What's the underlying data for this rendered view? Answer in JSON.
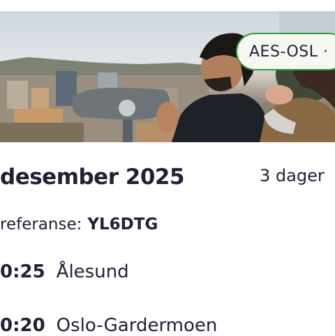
{
  "hero": {
    "image": "city-viewpoint-photo",
    "route_chip": "AES-OSL ·"
  },
  "trip": {
    "date_heading": "desember 2025",
    "days_until": "3 dager",
    "reference_label": "referanse:",
    "reference_code": "YL6DTG"
  },
  "legs": [
    {
      "time": "0:25",
      "place": "Ålesund"
    },
    {
      "time": "0:20",
      "place": "Oslo-Gardermoen"
    }
  ],
  "colors": {
    "chip_border": "#2e9a41",
    "text": "#1f2136"
  }
}
